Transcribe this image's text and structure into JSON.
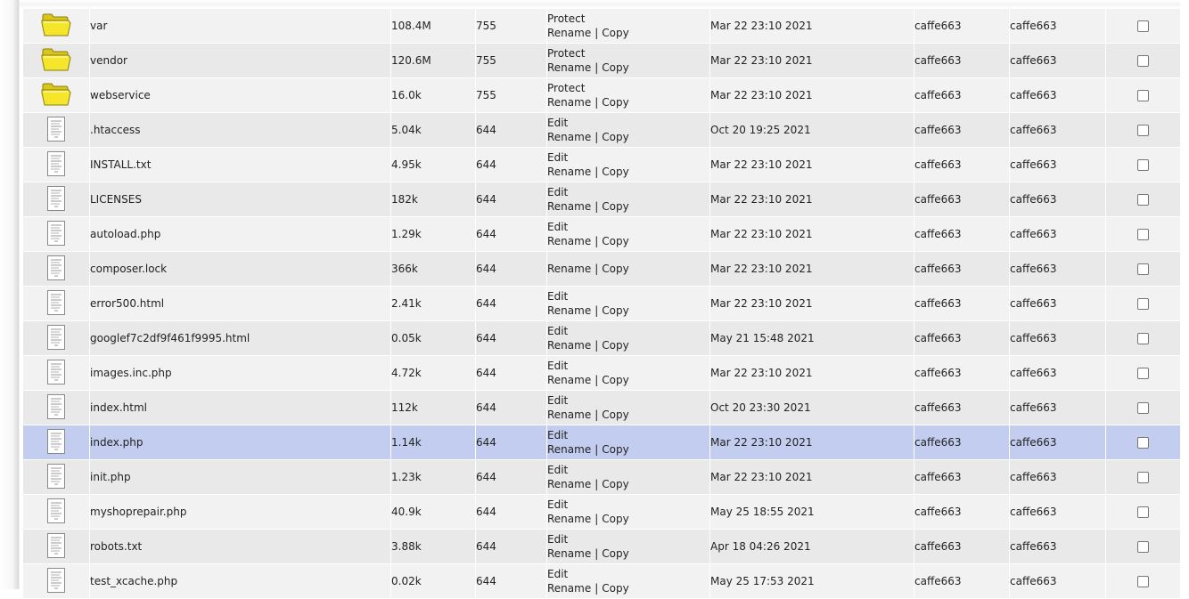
{
  "colors": {
    "row_odd": "#f2f2f2",
    "row_even": "#e9e9e9",
    "row_selected": "#c3cdef",
    "folder": "#f5e52b"
  },
  "icons": {
    "folder": "folder-icon",
    "file": "file-icon"
  },
  "rows": [
    {
      "icon": "folder",
      "name": "var",
      "size": "108.4M",
      "perm": "755",
      "actions": {
        "first": "Protect",
        "rename": "Rename",
        "sep": "|",
        "copy": "Copy"
      },
      "date": "Mar 22 23:10 2021",
      "user": "caffe663",
      "group": "caffe663",
      "selected": false
    },
    {
      "icon": "folder",
      "name": "vendor",
      "size": "120.6M",
      "perm": "755",
      "actions": {
        "first": "Protect",
        "rename": "Rename",
        "sep": "|",
        "copy": "Copy"
      },
      "date": "Mar 22 23:10 2021",
      "user": "caffe663",
      "group": "caffe663",
      "selected": false
    },
    {
      "icon": "folder",
      "name": "webservice",
      "size": "16.0k",
      "perm": "755",
      "actions": {
        "first": "Protect",
        "rename": "Rename",
        "sep": "|",
        "copy": "Copy"
      },
      "date": "Mar 22 23:10 2021",
      "user": "caffe663",
      "group": "caffe663",
      "selected": false
    },
    {
      "icon": "file",
      "name": ".htaccess",
      "size": "5.04k",
      "perm": "644",
      "actions": {
        "first": "Edit",
        "rename": "Rename",
        "sep": "|",
        "copy": "Copy"
      },
      "date": "Oct 20 19:25 2021",
      "user": "caffe663",
      "group": "caffe663",
      "selected": false
    },
    {
      "icon": "file",
      "name": "INSTALL.txt",
      "size": "4.95k",
      "perm": "644",
      "actions": {
        "first": "Edit",
        "rename": "Rename",
        "sep": "|",
        "copy": "Copy"
      },
      "date": "Mar 22 23:10 2021",
      "user": "caffe663",
      "group": "caffe663",
      "selected": false
    },
    {
      "icon": "file",
      "name": "LICENSES",
      "size": "182k",
      "perm": "644",
      "actions": {
        "first": "Edit",
        "rename": "Rename",
        "sep": "|",
        "copy": "Copy"
      },
      "date": "Mar 22 23:10 2021",
      "user": "caffe663",
      "group": "caffe663",
      "selected": false
    },
    {
      "icon": "file",
      "name": "autoload.php",
      "size": "1.29k",
      "perm": "644",
      "actions": {
        "first": "Edit",
        "rename": "Rename",
        "sep": "|",
        "copy": "Copy"
      },
      "date": "Mar 22 23:10 2021",
      "user": "caffe663",
      "group": "caffe663",
      "selected": false
    },
    {
      "icon": "file",
      "name": "composer.lock",
      "size": "366k",
      "perm": "644",
      "actions": {
        "first": null,
        "rename": "Rename",
        "sep": "|",
        "copy": "Copy"
      },
      "date": "Mar 22 23:10 2021",
      "user": "caffe663",
      "group": "caffe663",
      "selected": false
    },
    {
      "icon": "file",
      "name": "error500.html",
      "size": "2.41k",
      "perm": "644",
      "actions": {
        "first": "Edit",
        "rename": "Rename",
        "sep": "|",
        "copy": "Copy"
      },
      "date": "Mar 22 23:10 2021",
      "user": "caffe663",
      "group": "caffe663",
      "selected": false
    },
    {
      "icon": "file",
      "name": "googlef7c2df9f461f9995.html",
      "size": "0.05k",
      "perm": "644",
      "actions": {
        "first": "Edit",
        "rename": "Rename",
        "sep": "|",
        "copy": "Copy"
      },
      "date": "May 21 15:48 2021",
      "user": "caffe663",
      "group": "caffe663",
      "selected": false
    },
    {
      "icon": "file",
      "name": "images.inc.php",
      "size": "4.72k",
      "perm": "644",
      "actions": {
        "first": "Edit",
        "rename": "Rename",
        "sep": "|",
        "copy": "Copy"
      },
      "date": "Mar 22 23:10 2021",
      "user": "caffe663",
      "group": "caffe663",
      "selected": false
    },
    {
      "icon": "file",
      "name": "index.html",
      "size": "112k",
      "perm": "644",
      "actions": {
        "first": "Edit",
        "rename": "Rename",
        "sep": "|",
        "copy": "Copy"
      },
      "date": "Oct 20 23:30 2021",
      "user": "caffe663",
      "group": "caffe663",
      "selected": false
    },
    {
      "icon": "file",
      "name": "index.php",
      "size": "1.14k",
      "perm": "644",
      "actions": {
        "first": "Edit",
        "rename": "Rename",
        "sep": "|",
        "copy": "Copy"
      },
      "date": "Mar 22 23:10 2021",
      "user": "caffe663",
      "group": "caffe663",
      "selected": true
    },
    {
      "icon": "file",
      "name": "init.php",
      "size": "1.23k",
      "perm": "644",
      "actions": {
        "first": "Edit",
        "rename": "Rename",
        "sep": "|",
        "copy": "Copy"
      },
      "date": "Mar 22 23:10 2021",
      "user": "caffe663",
      "group": "caffe663",
      "selected": false
    },
    {
      "icon": "file",
      "name": "myshoprepair.php",
      "size": "40.9k",
      "perm": "644",
      "actions": {
        "first": "Edit",
        "rename": "Rename",
        "sep": "|",
        "copy": "Copy"
      },
      "date": "May 25 18:55 2021",
      "user": "caffe663",
      "group": "caffe663",
      "selected": false
    },
    {
      "icon": "file",
      "name": "robots.txt",
      "size": "3.88k",
      "perm": "644",
      "actions": {
        "first": "Edit",
        "rename": "Rename",
        "sep": "|",
        "copy": "Copy"
      },
      "date": "Apr 18 04:26 2021",
      "user": "caffe663",
      "group": "caffe663",
      "selected": false
    },
    {
      "icon": "file",
      "name": "test_xcache.php",
      "size": "0.02k",
      "perm": "644",
      "actions": {
        "first": "Edit",
        "rename": "Rename",
        "sep": "|",
        "copy": "Copy"
      },
      "date": "May 25 17:53 2021",
      "user": "caffe663",
      "group": "caffe663",
      "selected": false
    }
  ]
}
